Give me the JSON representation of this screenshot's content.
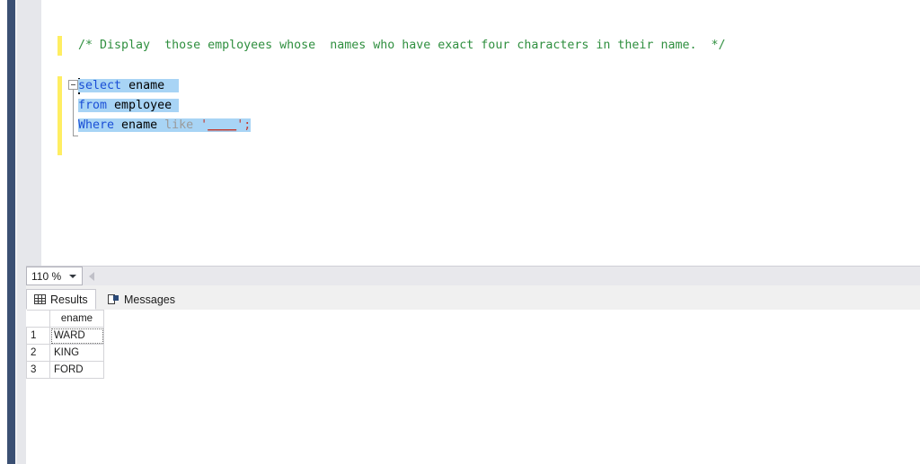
{
  "editor": {
    "comment": "/* Display  those employees whose  names who have exact four characters in their name.  */",
    "lines": [
      {
        "tokens": [
          {
            "text": "select",
            "style": "kw"
          },
          {
            "text": " ",
            "style": "plain"
          },
          {
            "text": "ename",
            "style": "plain"
          }
        ]
      },
      {
        "tokens": [
          {
            "text": "from",
            "style": "kw"
          },
          {
            "text": " ",
            "style": "plain"
          },
          {
            "text": "employee",
            "style": "plain"
          }
        ]
      },
      {
        "tokens": [
          {
            "text": "Where",
            "style": "kw"
          },
          {
            "text": " ",
            "style": "plain"
          },
          {
            "text": "ename",
            "style": "plain"
          },
          {
            "text": " ",
            "style": "plain"
          },
          {
            "text": "like",
            "style": "fn"
          },
          {
            "text": " ",
            "style": "plain"
          },
          {
            "text": "'",
            "style": "str"
          },
          {
            "text": "____",
            "style": "str-u"
          },
          {
            "text": "'",
            "style": "str"
          },
          {
            "text": ";",
            "style": "str"
          }
        ]
      }
    ],
    "line_1": "select ename",
    "line_2": "from employee",
    "line_3": "Where ename like '____';",
    "sql_text": "select ename\nfrom employee\nWhere ename like '____';",
    "fold_state": "expanded",
    "fold_glyph": "−",
    "colors": {
      "comment": "#2f8f3f",
      "keyword": "#1a4fd6",
      "identifier": "#000000",
      "operator": "#9a9a9a",
      "string": "#c43a2f",
      "selection": "#a8d4f5",
      "change_bar": "#ffee62"
    }
  },
  "status_bar": {
    "zoom_value": "110 %",
    "zoom_dropdown_icon": "chevron-down-icon",
    "scroll_left_icon": "scroll-left-arrow-icon"
  },
  "results_panel": {
    "tabs": [
      {
        "label": "Results",
        "icon": "grid-icon",
        "active": true
      },
      {
        "label": "Messages",
        "icon": "message-icon",
        "active": false
      }
    ],
    "grid": {
      "row_number_header": "",
      "columns": [
        "ename"
      ],
      "rows": [
        {
          "num": "1",
          "ename": "WARD",
          "selected": true
        },
        {
          "num": "2",
          "ename": "KING",
          "selected": false
        },
        {
          "num": "3",
          "ename": "FORD",
          "selected": false
        }
      ]
    }
  }
}
